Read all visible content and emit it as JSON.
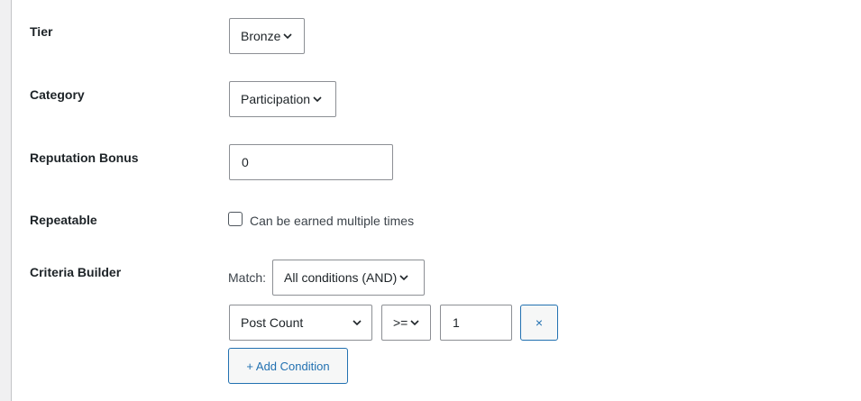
{
  "fields": {
    "tier": {
      "label": "Tier",
      "value": "Bronze"
    },
    "category": {
      "label": "Category",
      "value": "Participation"
    },
    "reputation_bonus": {
      "label": "Reputation Bonus",
      "value": "0"
    },
    "repeatable": {
      "label": "Repeatable",
      "checkbox_label": "Can be earned multiple times",
      "checked": false
    },
    "criteria_builder": {
      "label": "Criteria Builder",
      "match_label": "Match:",
      "match_value": "All conditions (AND)",
      "condition": {
        "metric": "Post Count",
        "operator": ">=",
        "value": "1",
        "remove_label": "×"
      },
      "add_condition_label": "+ Add Condition"
    }
  },
  "colors": {
    "accent": "#2271b1",
    "border": "#8c8f94",
    "background": "#f0f0f1"
  },
  "icons": [
    "chevron-down-icon"
  ]
}
